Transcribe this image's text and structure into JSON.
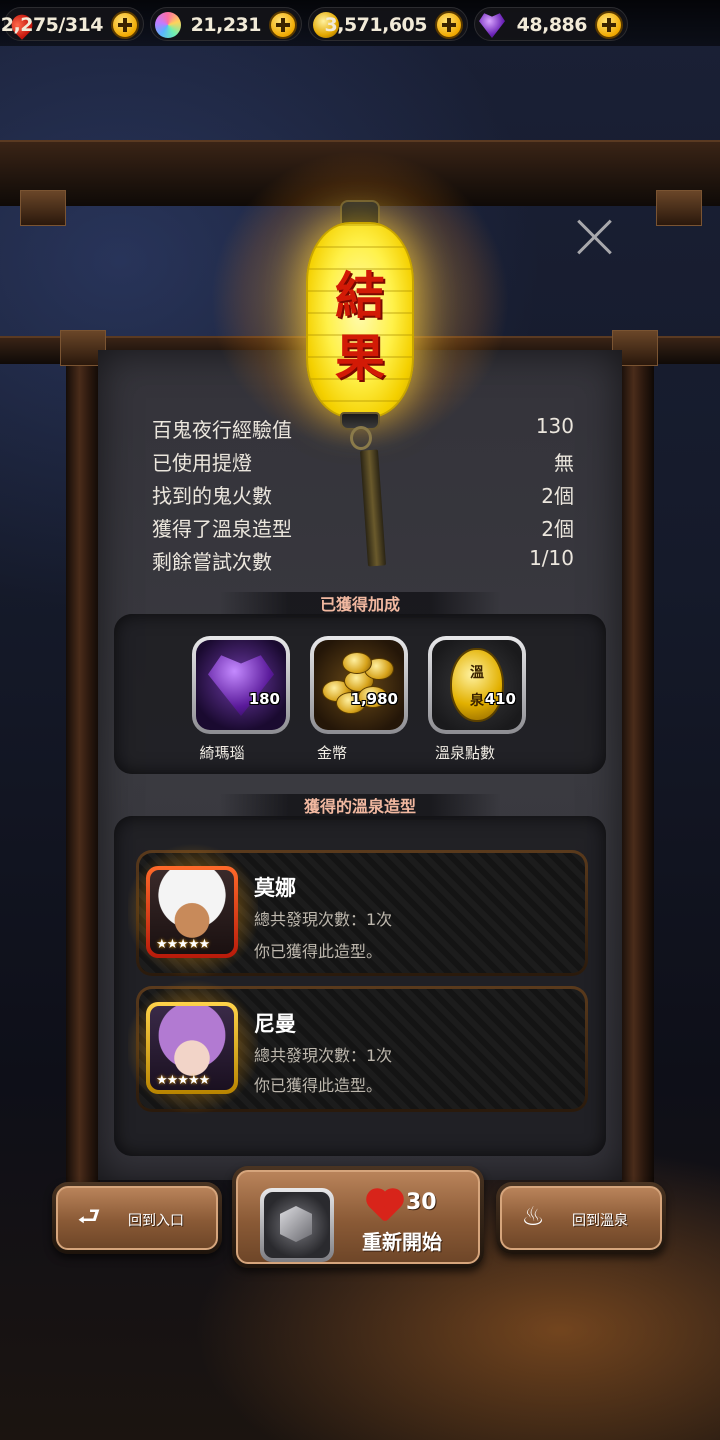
{
  "resources": [
    {
      "icon": "heart-icon",
      "value": "2,275",
      "max": "/314"
    },
    {
      "icon": "rainbow-gem-icon",
      "value": "21,231"
    },
    {
      "icon": "gold-coin-icon",
      "value": "3,571,605"
    },
    {
      "icon": "purple-gem-icon",
      "value": "48,886"
    }
  ],
  "lantern_text": [
    "結",
    "果"
  ],
  "stats": [
    {
      "label": "百鬼夜行經驗值",
      "value": "130"
    },
    {
      "label": "已使用提燈",
      "value": "無"
    },
    {
      "label": "找到的鬼火數",
      "value": "2個"
    },
    {
      "label": "獲得了溫泉造型",
      "value": "2個"
    },
    {
      "label": "剩餘嘗試次數",
      "value": "1/10"
    }
  ],
  "bonus_section": {
    "title": "已獲得加成",
    "items": [
      {
        "name": "綺瑪瑙",
        "amount": "180",
        "icon": "purple-agate-icon"
      },
      {
        "name": "金幣",
        "amount": "1,980",
        "icon": "gold-coins-icon"
      },
      {
        "name": "溫泉點數",
        "amount": "410",
        "icon": "hot-spring-token-icon",
        "token_text": [
          "溫",
          "泉"
        ]
      }
    ]
  },
  "costume_section": {
    "title": "獲得的溫泉造型",
    "cards": [
      {
        "name": "莫娜",
        "found_count": "總共發現次數：1次",
        "status": "你已獲得此造型。",
        "stars": "★★★★★"
      },
      {
        "name": "尼曼",
        "found_count": "總共發現次數：1次",
        "status": "你已獲得此造型。",
        "stars": "★★★★★"
      }
    ]
  },
  "buttons": {
    "back_entrance": "回到入口",
    "restart": "重新開始",
    "restart_cost": "30",
    "back_hotspring": "回到溫泉"
  },
  "colors": {
    "accent_gold": "#f0a900",
    "lantern_yellow": "#fff14a",
    "heading_pink": "#f1b8a0",
    "button_wood": "#8a5a36"
  }
}
